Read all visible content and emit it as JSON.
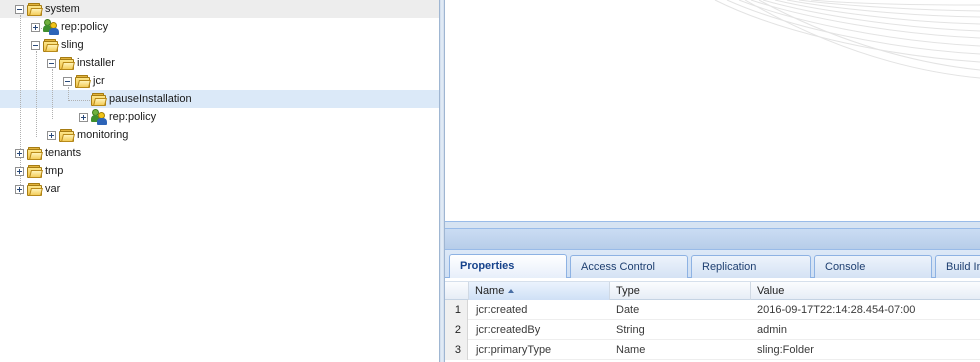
{
  "tree": {
    "nodes": [
      {
        "label": "system",
        "icon": "folder-icon"
      },
      {
        "label": "rep:policy",
        "icon": "users-icon"
      },
      {
        "label": "sling",
        "icon": "folder-icon"
      },
      {
        "label": "installer",
        "icon": "folder-icon"
      },
      {
        "label": "jcr",
        "icon": "folder-icon"
      },
      {
        "label": "pauseInstallation",
        "icon": "folder-icon",
        "selected": true
      },
      {
        "label": "rep:policy",
        "icon": "users-icon"
      },
      {
        "label": "monitoring",
        "icon": "folder-icon"
      },
      {
        "label": "tenants",
        "icon": "folder-icon"
      },
      {
        "label": "tmp",
        "icon": "folder-icon"
      },
      {
        "label": "var",
        "icon": "folder-icon"
      }
    ]
  },
  "tabs": [
    {
      "label": "Properties",
      "active": true
    },
    {
      "label": "Access Control"
    },
    {
      "label": "Replication"
    },
    {
      "label": "Console"
    },
    {
      "label": "Build In"
    }
  ],
  "properties": {
    "columns": [
      "Name",
      "Type",
      "Value"
    ],
    "sort_column": "Name",
    "rows": [
      {
        "num": "1",
        "name": "jcr:created",
        "type": "Date",
        "value": "2016-09-17T22:14:28.454-07:00"
      },
      {
        "num": "2",
        "name": "jcr:createdBy",
        "type": "String",
        "value": "admin"
      },
      {
        "num": "3",
        "name": "jcr:primaryType",
        "type": "Name",
        "value": "sling:Folder"
      }
    ]
  },
  "colors": {
    "accent": "#15428b",
    "panel_border": "#99bbe8",
    "selection": "#dbe9f8"
  }
}
